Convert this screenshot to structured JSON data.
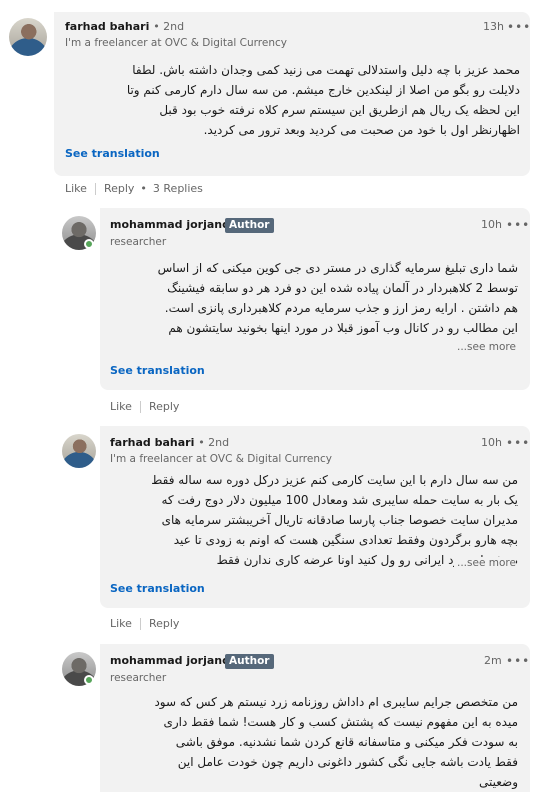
{
  "comments": [
    {
      "name": "farhad bahari",
      "degree": "• 2nd",
      "headline": "I'm a freelancer at OVC & Digital Currency",
      "time": "13h",
      "lines": [
        "محمد عزیز با چه دلیل واستدلالی تهمت می زنید کمی وجدان داشته باش. لطفا",
        "دلایلت رو بگو من اصلا از لینکدین خارج میشم. من سه سال دارم کارمی کنم وتا",
        "این لحظه یک ریال هم ازطریق این سیستم سرم کلاه نرفته خوب بود قبل",
        "اظهارنظر اول با خود من صحبت می کردید وبعد ترور می کردید."
      ],
      "see_translation": "See translation",
      "like": "Like",
      "reply": "Reply",
      "replies": "3 Replies"
    },
    {
      "name": "mohammad jorjandi",
      "badge": "Author",
      "headline": "researcher",
      "time": "10h",
      "lines": [
        "شما داری تبلیغ سرمایه گذاری در مستر دی جی کوین میکنی که از اساس",
        "توسط 2 کلاهبردار در آلمان پیاده شده این دو فرد هر دو سابقه فیشینگ",
        "هم داشتن . ارایه رمز ارز و جذب سرمایه مردم کلاهبرداری پانزی است.",
        "این مطالب رو در کانال وب آموز قبلا در مورد اینها بخونید سایتشون هم"
      ],
      "see_more": "...see more",
      "see_translation": "See translation",
      "like": "Like",
      "reply": "Reply"
    },
    {
      "name": "farhad bahari",
      "degree": "• 2nd",
      "headline": "I'm a freelancer at OVC & Digital Currency",
      "time": "10h",
      "lines": [
        "من سه سال دارم با این سایت کارمی کنم عزیز درکل دوره سه ساله فقط",
        "یک بار به سایت حمله سایبری شد ومعادل 100 میلیون دلار دوج رفت که",
        "مدیران سایت خصوصا جناب پارسا صادقانه تاریال آخریبشتر سرمایه های",
        "بچه هارو برگردون وفقط تعدادی سنگین هست که اونم به زودی تا عید",
        "ه.نشریات زرد ایرانی رو ول کنید اونا عرضه کاری ندارن فقط"
      ],
      "see_more": "...see more",
      "see_translation": "See translation",
      "like": "Like",
      "reply": "Reply"
    },
    {
      "name": "mohammad jorjandi",
      "badge": "Author",
      "headline": "researcher",
      "time": "2m",
      "lines": [
        "من متخصص جرایم سایبری ام داداش روزنامه زرد نیستم هر کس که سود",
        "میده به این مفهوم نیست که پشتش کسب و کار هست! شما فقط داری",
        "به سودت فکر میکنی و متاسفانه قانع کردن شما نشدنیه. موفق باشی",
        "فقط یادت باشه جایی نگی کشور داغونی داریم چون خودت عامل این",
        "وضعیتی"
      ]
    }
  ]
}
